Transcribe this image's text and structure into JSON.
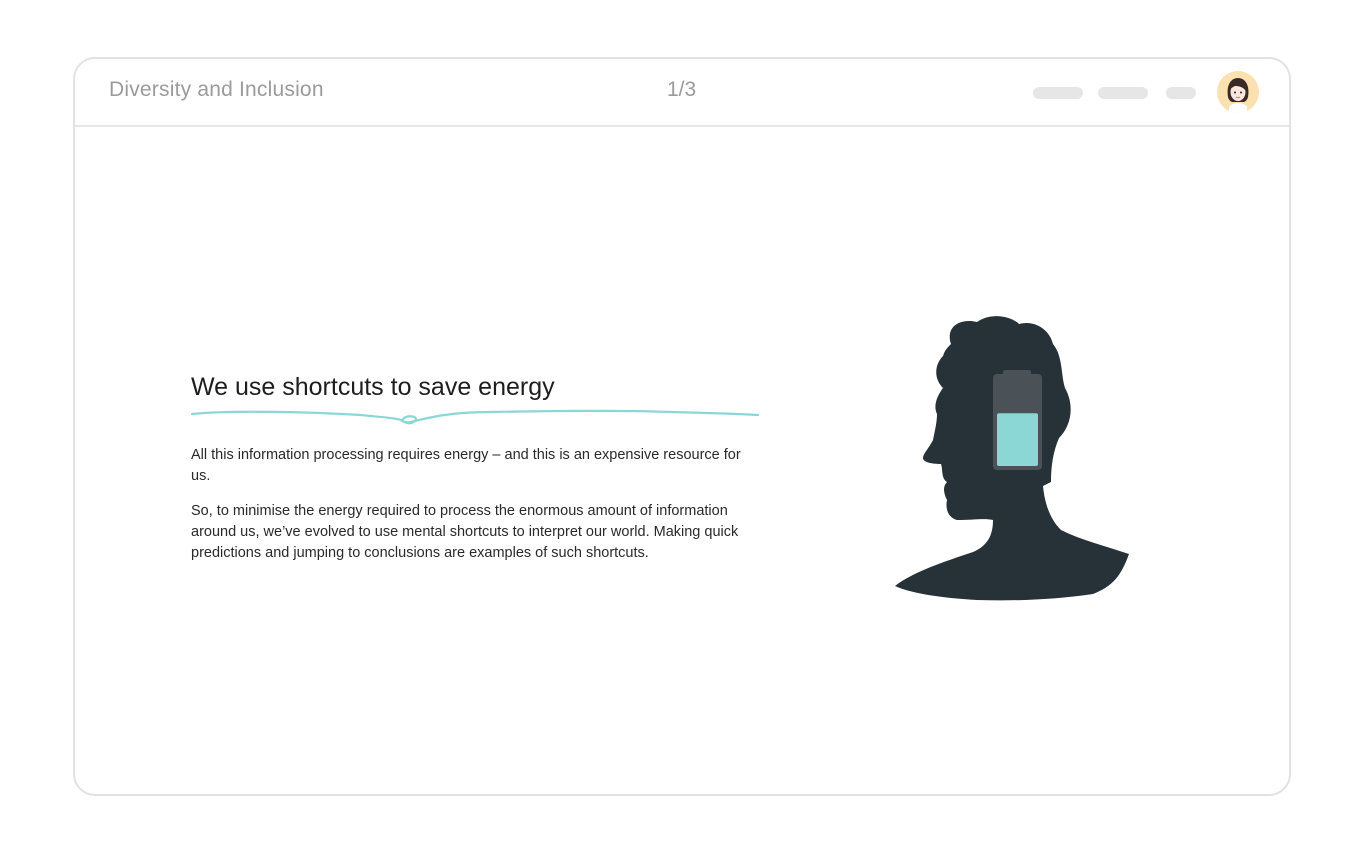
{
  "header": {
    "course_title": "Diversity and Inclusion",
    "page_indicator": "1/3"
  },
  "slide": {
    "heading": "We use shortcuts to save energy",
    "paragraphs": [
      "All this information processing requires energy – and this is an expensive resource for us.",
      "So, to minimise the energy required to process the enormous amount of information around us, we’ve evolved to use mental shortcuts to interpret our world. Making quick predictions and jumping to conclusions are examples of such shortcuts."
    ],
    "battery_level": 0.6
  },
  "colors": {
    "accent": "#8bd7d6",
    "silhouette": "#263238",
    "battery_body": "#4a5257",
    "avatar_bg": "#fbe0b0"
  },
  "icons": {
    "avatar": "user-avatar-icon",
    "illustration": "head-battery-illustration"
  }
}
